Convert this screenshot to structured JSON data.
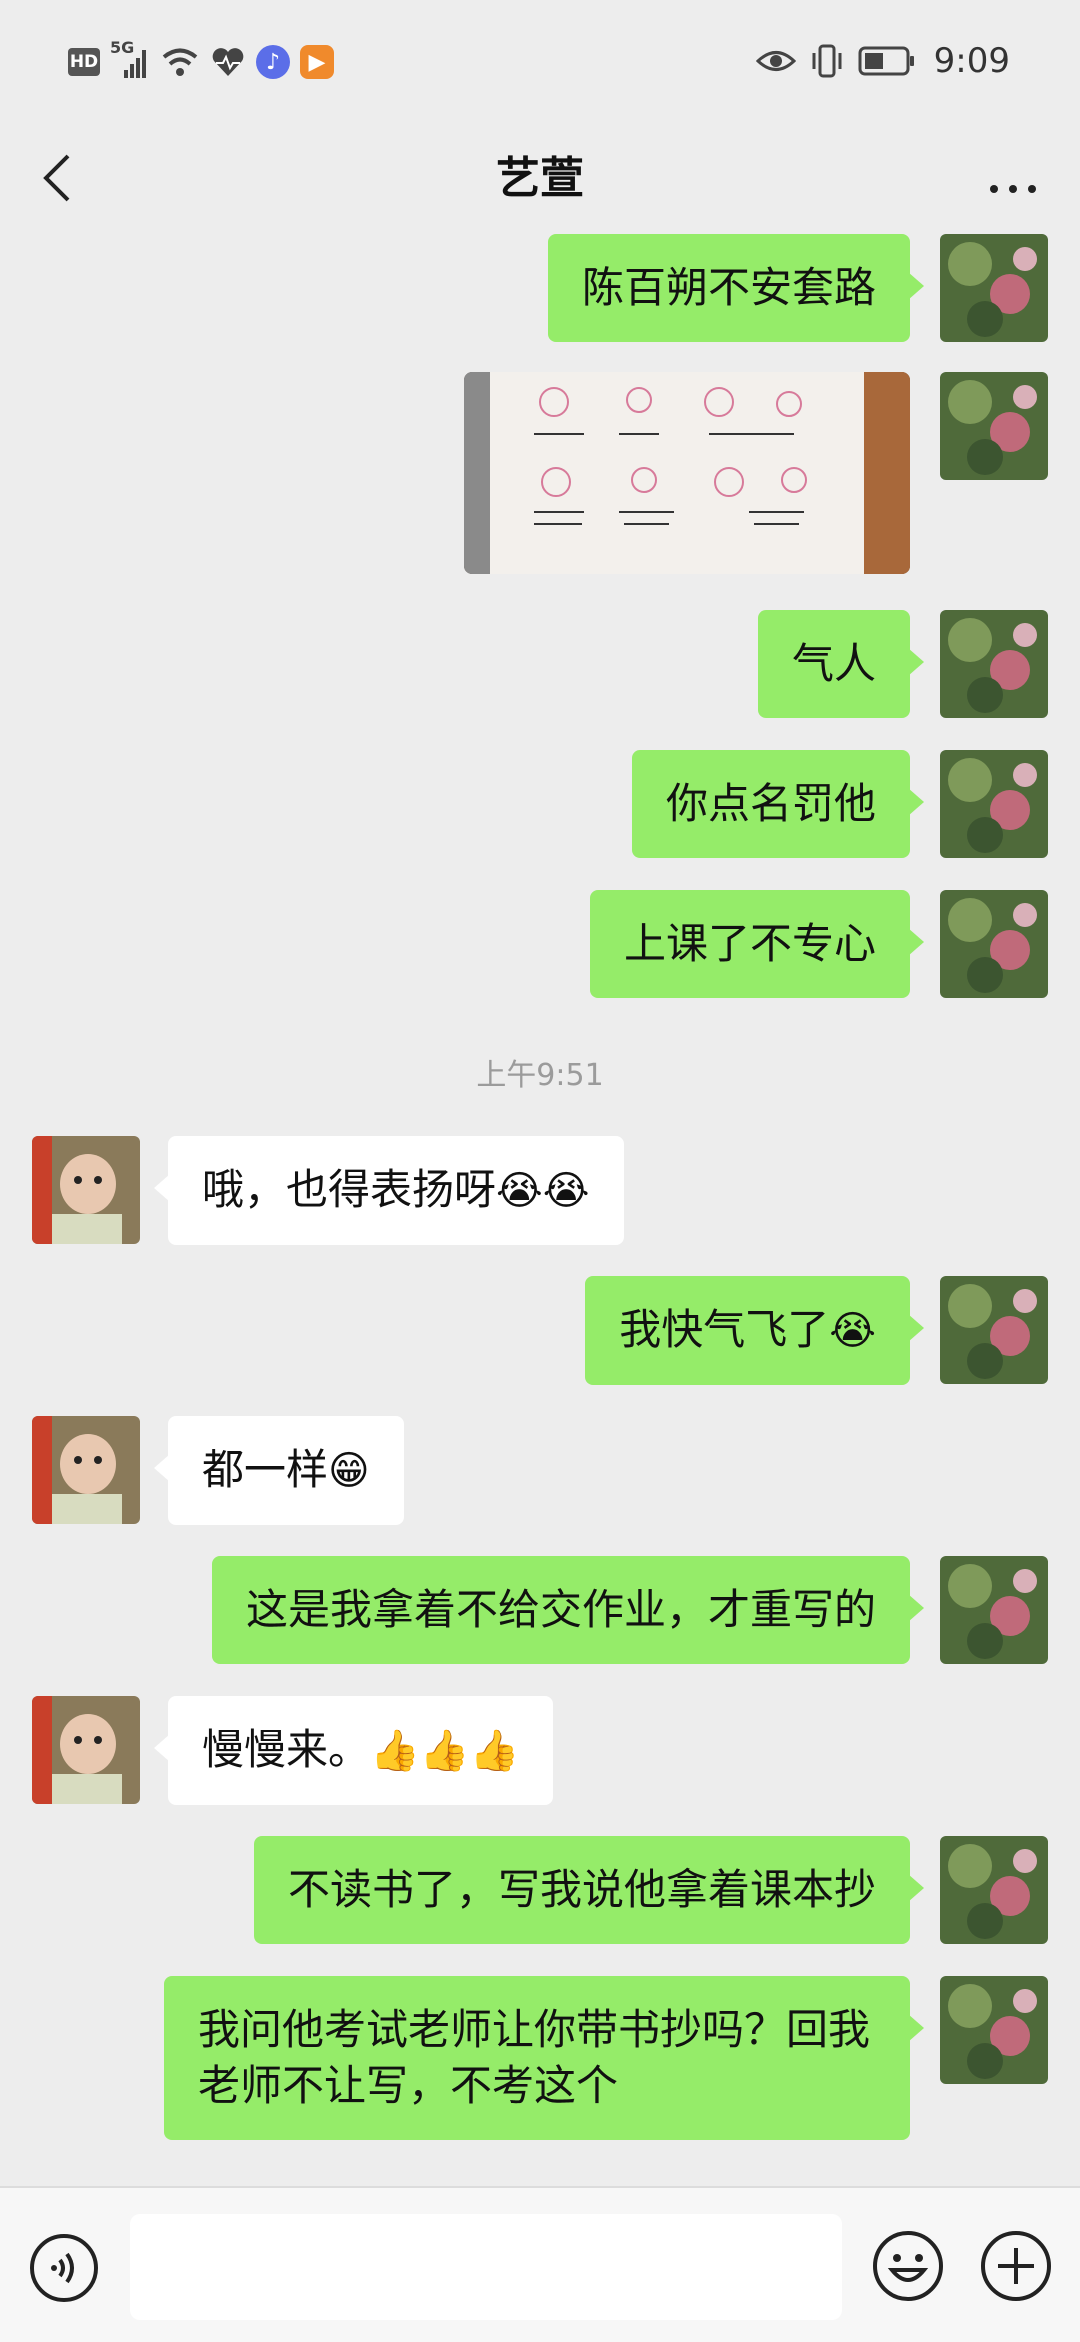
{
  "status_bar": {
    "hd": "HD",
    "network": "5G",
    "time": "9:09",
    "icons": [
      "hd-icon",
      "signal-icon",
      "wifi-icon",
      "heart-icon",
      "music-app-icon",
      "video-app-icon",
      "eye-icon",
      "vibrate-icon",
      "battery-icon"
    ]
  },
  "header": {
    "title": "艺萱",
    "back_icon": "chevron-left-icon",
    "more_icon": "more-dots-icon"
  },
  "messages": [
    {
      "side": "out",
      "text": "陈百朔不安套路"
    },
    {
      "side": "out",
      "type": "image",
      "description": "photo of worksheet"
    },
    {
      "side": "out",
      "text": "气人"
    },
    {
      "side": "out",
      "text": "你点名罚他"
    },
    {
      "side": "out",
      "text": "上课了不专心"
    },
    {
      "type": "timestamp",
      "text": "上午9:51"
    },
    {
      "side": "in",
      "text": "哦，也得表扬呀",
      "emoji": "😭😭"
    },
    {
      "side": "out",
      "text": "我快气飞了",
      "emoji": "😭"
    },
    {
      "side": "in",
      "text": "都一样",
      "emoji": "😁"
    },
    {
      "side": "out",
      "text": "这是我拿着不给交作业，才重写的"
    },
    {
      "side": "in",
      "text": "慢慢来。",
      "emoji": "👍👍👍"
    },
    {
      "side": "out",
      "text": "不读书了，写我说他拿着课本抄"
    },
    {
      "side": "out",
      "text": "我问他考试老师让你带书抄吗？回我老师不让写，不考这个"
    }
  ],
  "input_bar": {
    "placeholder": "",
    "voice_icon": "voice-icon",
    "emoji_icon": "emoji-icon",
    "plus_icon": "plus-icon"
  },
  "colors": {
    "background": "#ededed",
    "outgoing_bubble": "#95ec69",
    "incoming_bubble": "#ffffff",
    "timestamp": "#9b9b9b"
  }
}
